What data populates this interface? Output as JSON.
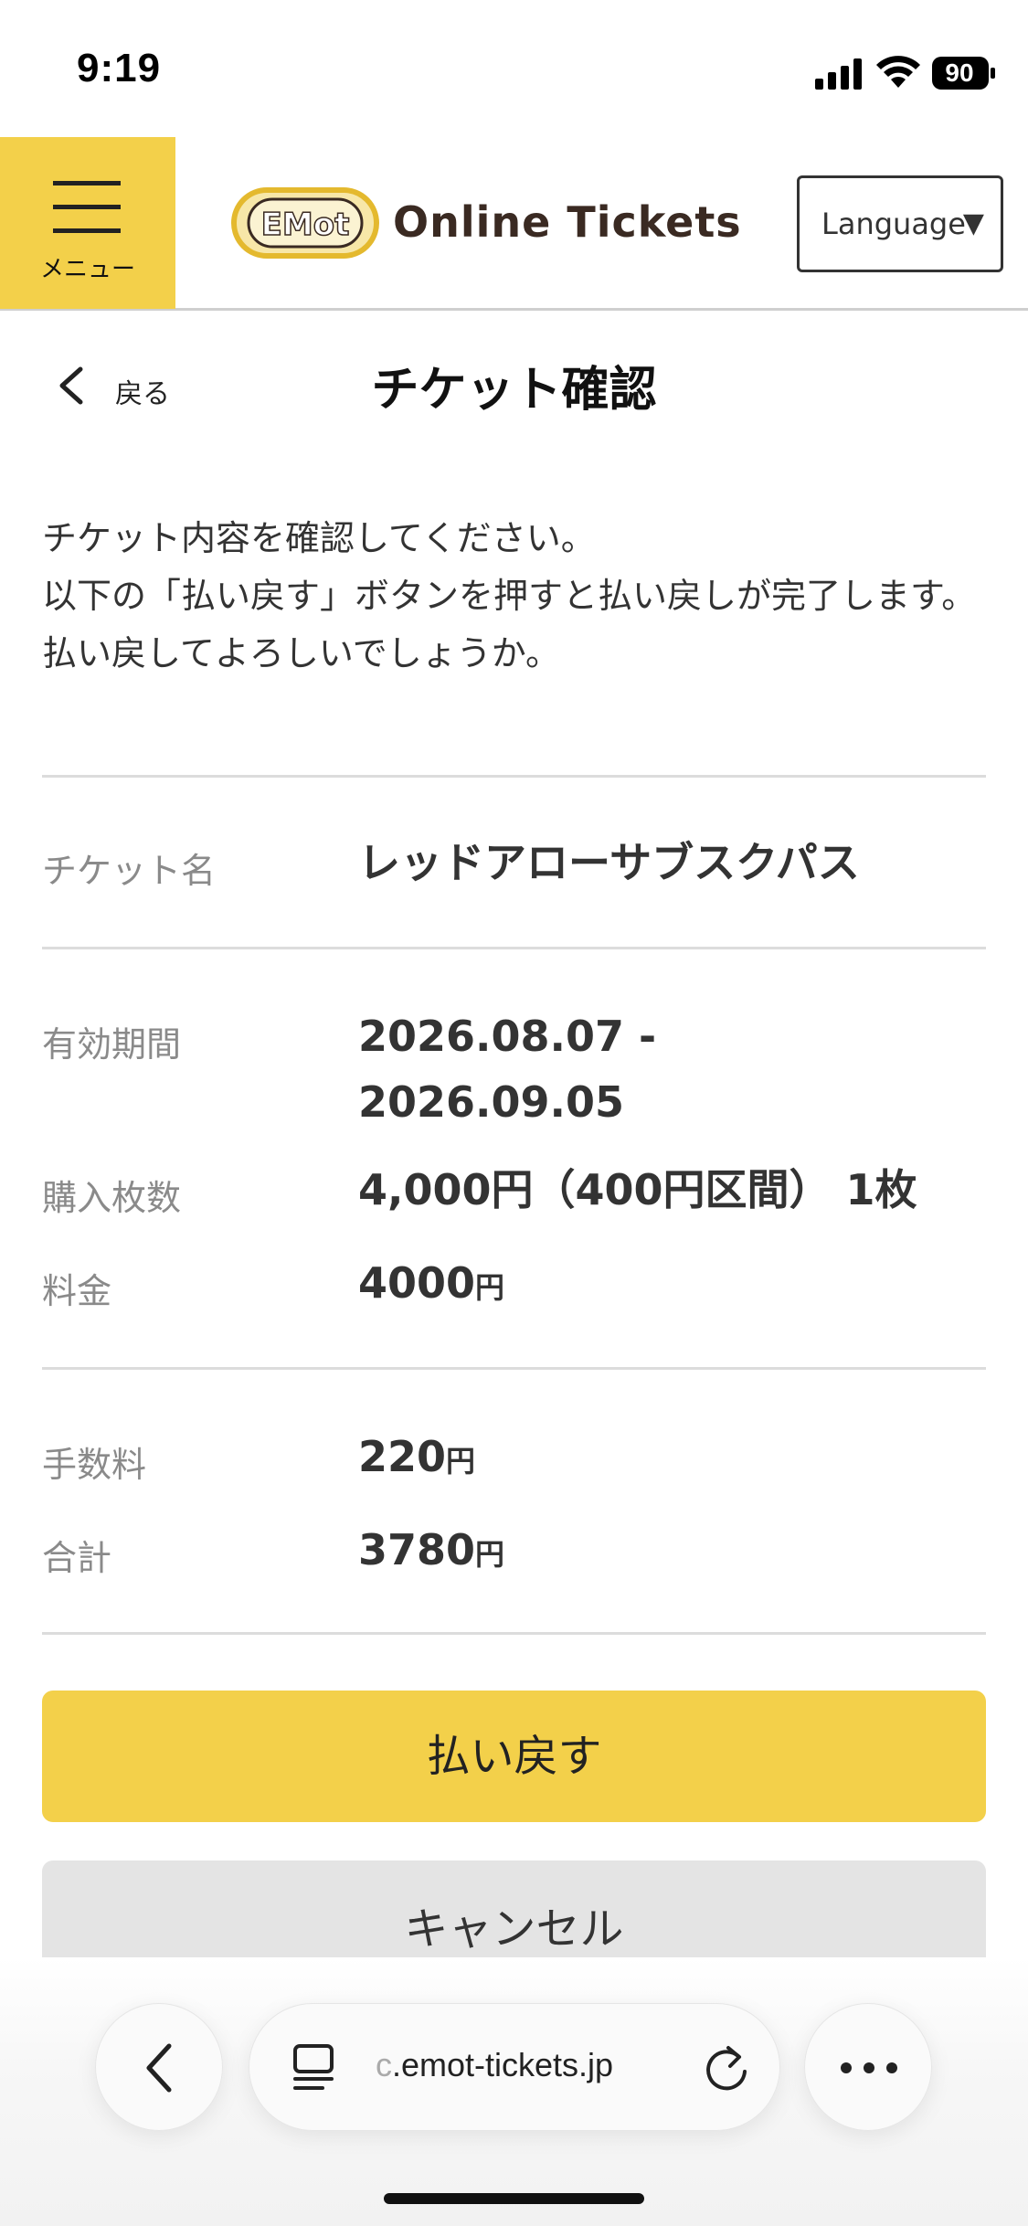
{
  "status_bar": {
    "time": "9:19",
    "battery": "90"
  },
  "header": {
    "menu_label": "メニュー",
    "logo_mark": "EMot",
    "logo_text": "Online Tickets",
    "language_label": "Language",
    "language_arrow": "▼"
  },
  "title_bar": {
    "back_label": "戻る",
    "title": "チケット確認"
  },
  "intro": {
    "line1": "チケット内容を確認してください。",
    "line2": "以下の「払い戻す」ボタンを押すと払い戻しが完了します。",
    "line3": "払い戻してよろしいでしょうか。"
  },
  "details": {
    "ticket_name_label": "チケット名",
    "ticket_name_value": "レッドアローサブスクパス",
    "validity_label": "有効期間",
    "validity_start": "2026.08.07 -",
    "validity_end": "2026.09.05",
    "quantity_label": "購入枚数",
    "quantity_value": "4,000円（400円区間） 1枚",
    "price_label": "料金",
    "price_value": "4000",
    "fee_label": "手数料",
    "fee_value": "220",
    "total_label": "合計",
    "total_value": "3780",
    "yen": "円"
  },
  "buttons": {
    "refund": "払い戻す",
    "cancel": "キャンセル"
  },
  "browser": {
    "url_faded": "c",
    "url": ".emot-tickets.jp"
  },
  "colors": {
    "accent": "#f3d04a",
    "label_gray": "#8a8a8a"
  }
}
